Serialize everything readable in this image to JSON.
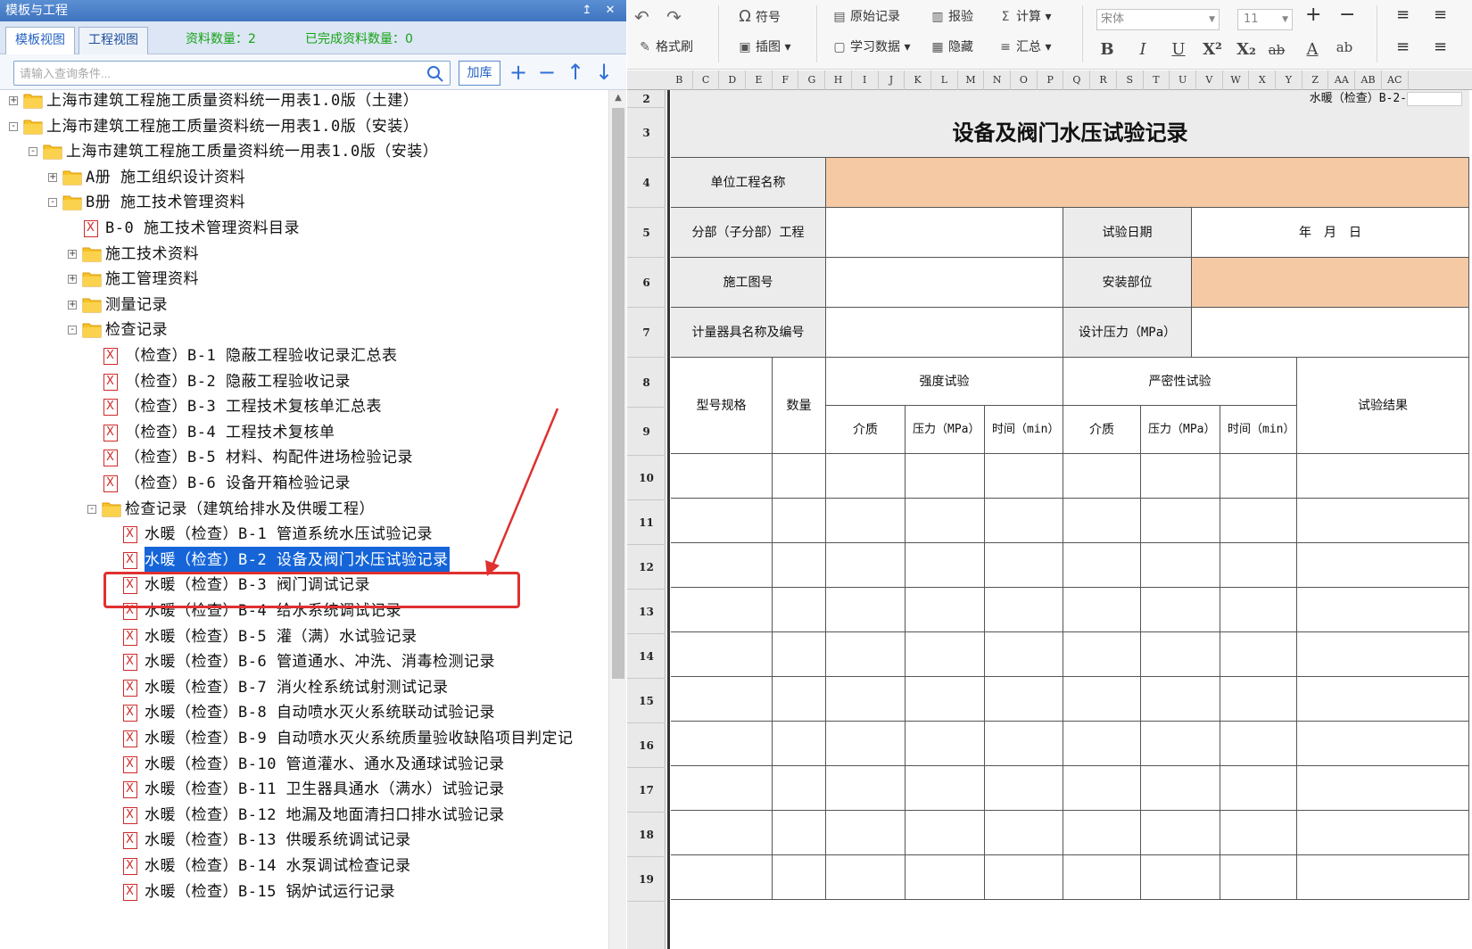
{
  "left_panel": {
    "title": "模板与工程",
    "pin_icon": "pin-icon",
    "close_icon": "close-icon",
    "tabs": [
      {
        "label": "模板视图",
        "active": true
      },
      {
        "label": "工程视图",
        "active": false
      }
    ],
    "stats": {
      "count_label": "资料数量：2",
      "done_label": "已完成资料数量：0"
    },
    "search": {
      "placeholder": "请输入查询条件...",
      "add_lib_label": "加库"
    },
    "actions": [
      "plus-icon",
      "minus-icon",
      "arrow-up-icon",
      "arrow-down-icon"
    ],
    "tree": [
      {
        "label": "上海市建筑工程施工质量资料统一用表1.0版（土建）",
        "level": 0,
        "type": "folder",
        "toggle": "+"
      },
      {
        "label": "上海市建筑工程施工质量资料统一用表1.0版（安装）",
        "level": 0,
        "type": "folder",
        "toggle": "-"
      },
      {
        "label": "上海市建筑工程施工质量资料统一用表1.0版（安装）",
        "level": 1,
        "type": "folder",
        "toggle": "-"
      },
      {
        "label": "A册 施工组织设计资料",
        "level": 2,
        "type": "folder",
        "toggle": "+"
      },
      {
        "label": "B册 施工技术管理资料",
        "level": 2,
        "type": "folder",
        "toggle": "-"
      },
      {
        "label": "B-0 施工技术管理资料目录",
        "level": 3,
        "type": "doc"
      },
      {
        "label": "施工技术资料",
        "level": 3,
        "type": "folder",
        "toggle": "+"
      },
      {
        "label": "施工管理资料",
        "level": 3,
        "type": "folder",
        "toggle": "+"
      },
      {
        "label": "测量记录",
        "level": 3,
        "type": "folder",
        "toggle": "+"
      },
      {
        "label": "检查记录",
        "level": 3,
        "type": "folder",
        "toggle": "-"
      },
      {
        "label": "（检查）B-1 隐蔽工程验收记录汇总表",
        "level": 4,
        "type": "doc"
      },
      {
        "label": "（检查）B-2 隐蔽工程验收记录",
        "level": 4,
        "type": "doc"
      },
      {
        "label": "（检查）B-3 工程技术复核单汇总表",
        "level": 4,
        "type": "doc"
      },
      {
        "label": "（检查）B-4 工程技术复核单",
        "level": 4,
        "type": "doc"
      },
      {
        "label": "（检查）B-5 材料、构配件进场检验记录",
        "level": 4,
        "type": "doc"
      },
      {
        "label": "（检查）B-6 设备开箱检验记录",
        "level": 4,
        "type": "doc"
      },
      {
        "label": "检查记录（建筑给排水及供暖工程）",
        "level": 4,
        "type": "folder",
        "toggle": "-"
      },
      {
        "label": "水暖（检查）B-1 管道系统水压试验记录",
        "level": 5,
        "type": "doc"
      },
      {
        "label": "水暖（检查）B-2 设备及阀门水压试验记录",
        "level": 5,
        "type": "doc",
        "selected": true
      },
      {
        "label": "水暖（检查）B-3 阀门调试记录",
        "level": 5,
        "type": "doc"
      },
      {
        "label": "水暖（检查）B-4 给水系统调试记录",
        "level": 5,
        "type": "doc"
      },
      {
        "label": "水暖（检查）B-5 灌（满）水试验记录",
        "level": 5,
        "type": "doc"
      },
      {
        "label": "水暖（检查）B-6 管道通水、冲洗、消毒检测记录",
        "level": 5,
        "type": "doc"
      },
      {
        "label": "水暖（检查）B-7 消火栓系统试射测试记录",
        "level": 5,
        "type": "doc"
      },
      {
        "label": "水暖（检查）B-8 自动喷水灭火系统联动试验记录",
        "level": 5,
        "type": "doc"
      },
      {
        "label": "水暖（检查）B-9 自动喷水灭火系统质量验收缺陷项目判定记",
        "level": 5,
        "type": "doc"
      },
      {
        "label": "水暖（检查）B-10 管道灌水、通水及通球试验记录",
        "level": 5,
        "type": "doc"
      },
      {
        "label": "水暖（检查）B-11 卫生器具通水（满水）试验记录",
        "level": 5,
        "type": "doc"
      },
      {
        "label": "水暖（检查）B-12 地漏及地面清扫口排水试验记录",
        "level": 5,
        "type": "doc"
      },
      {
        "label": "水暖（检查）B-13 供暖系统调试记录",
        "level": 5,
        "type": "doc"
      },
      {
        "label": "水暖（检查）B-14 水泵调试检查记录",
        "level": 5,
        "type": "doc"
      },
      {
        "label": "水暖（检查）B-15 锅炉试运行记录",
        "level": 5,
        "type": "doc"
      }
    ]
  },
  "ribbon": {
    "undo_icon": "undo-icon",
    "redo_icon": "redo-icon",
    "format_painter": "格式刷",
    "symbol": "符号",
    "insert_image": "插图",
    "original_record": "原始记录",
    "study_data": "学习数据",
    "inspection": "报验",
    "hide": "隐藏",
    "calculate": "计算",
    "summary": "汇总",
    "font_name": "宋体",
    "font_size": "11",
    "font_grow": "+",
    "font_shrink": "−",
    "bold": "B",
    "italic": "I",
    "underline": "U",
    "superscript": "X²",
    "subscript": "X₂",
    "strikethrough": "ab",
    "font_color": "A",
    "phonetic": "ab"
  },
  "sheet": {
    "columns": [
      "B",
      "C",
      "D",
      "E",
      "F",
      "G",
      "H",
      "I",
      "J",
      "K",
      "L",
      "M",
      "N",
      "O",
      "P",
      "Q",
      "R",
      "S",
      "T",
      "U",
      "V",
      "W",
      "X",
      "Y",
      "Z",
      "AA",
      "AB",
      "AC"
    ],
    "rows": [
      "2",
      "3",
      "4",
      "5",
      "6",
      "7",
      "8",
      "9",
      "10",
      "11",
      "12",
      "13",
      "14",
      "15",
      "16",
      "17",
      "18",
      "19"
    ],
    "form": {
      "code": "水暖（检查）B-2-",
      "title": "设备及阀门水压试验记录",
      "unit_name_label": "单位工程名称",
      "subproject_label": "分部（子分部）工程",
      "test_date_label": "试验日期",
      "date_value": "年　月　日",
      "drawing_no_label": "施工图号",
      "install_location_label": "安装部位",
      "gauge_label": "计量器具名称及编号",
      "design_pressure_label": "设计压力（MPa）",
      "model_label": "型号规格",
      "quantity_label": "数量",
      "strength_test_label": "强度试验",
      "tightness_test_label": "严密性试验",
      "result_label": "试验结果",
      "medium_label": "介质",
      "pressure_label": "压力（MPa）",
      "time_label": "时间（min）"
    }
  },
  "colors": {
    "accent": "#1565d8",
    "highlight": "#f4c9a4",
    "annotation": "#e03030",
    "stat_green": "#16a316"
  }
}
